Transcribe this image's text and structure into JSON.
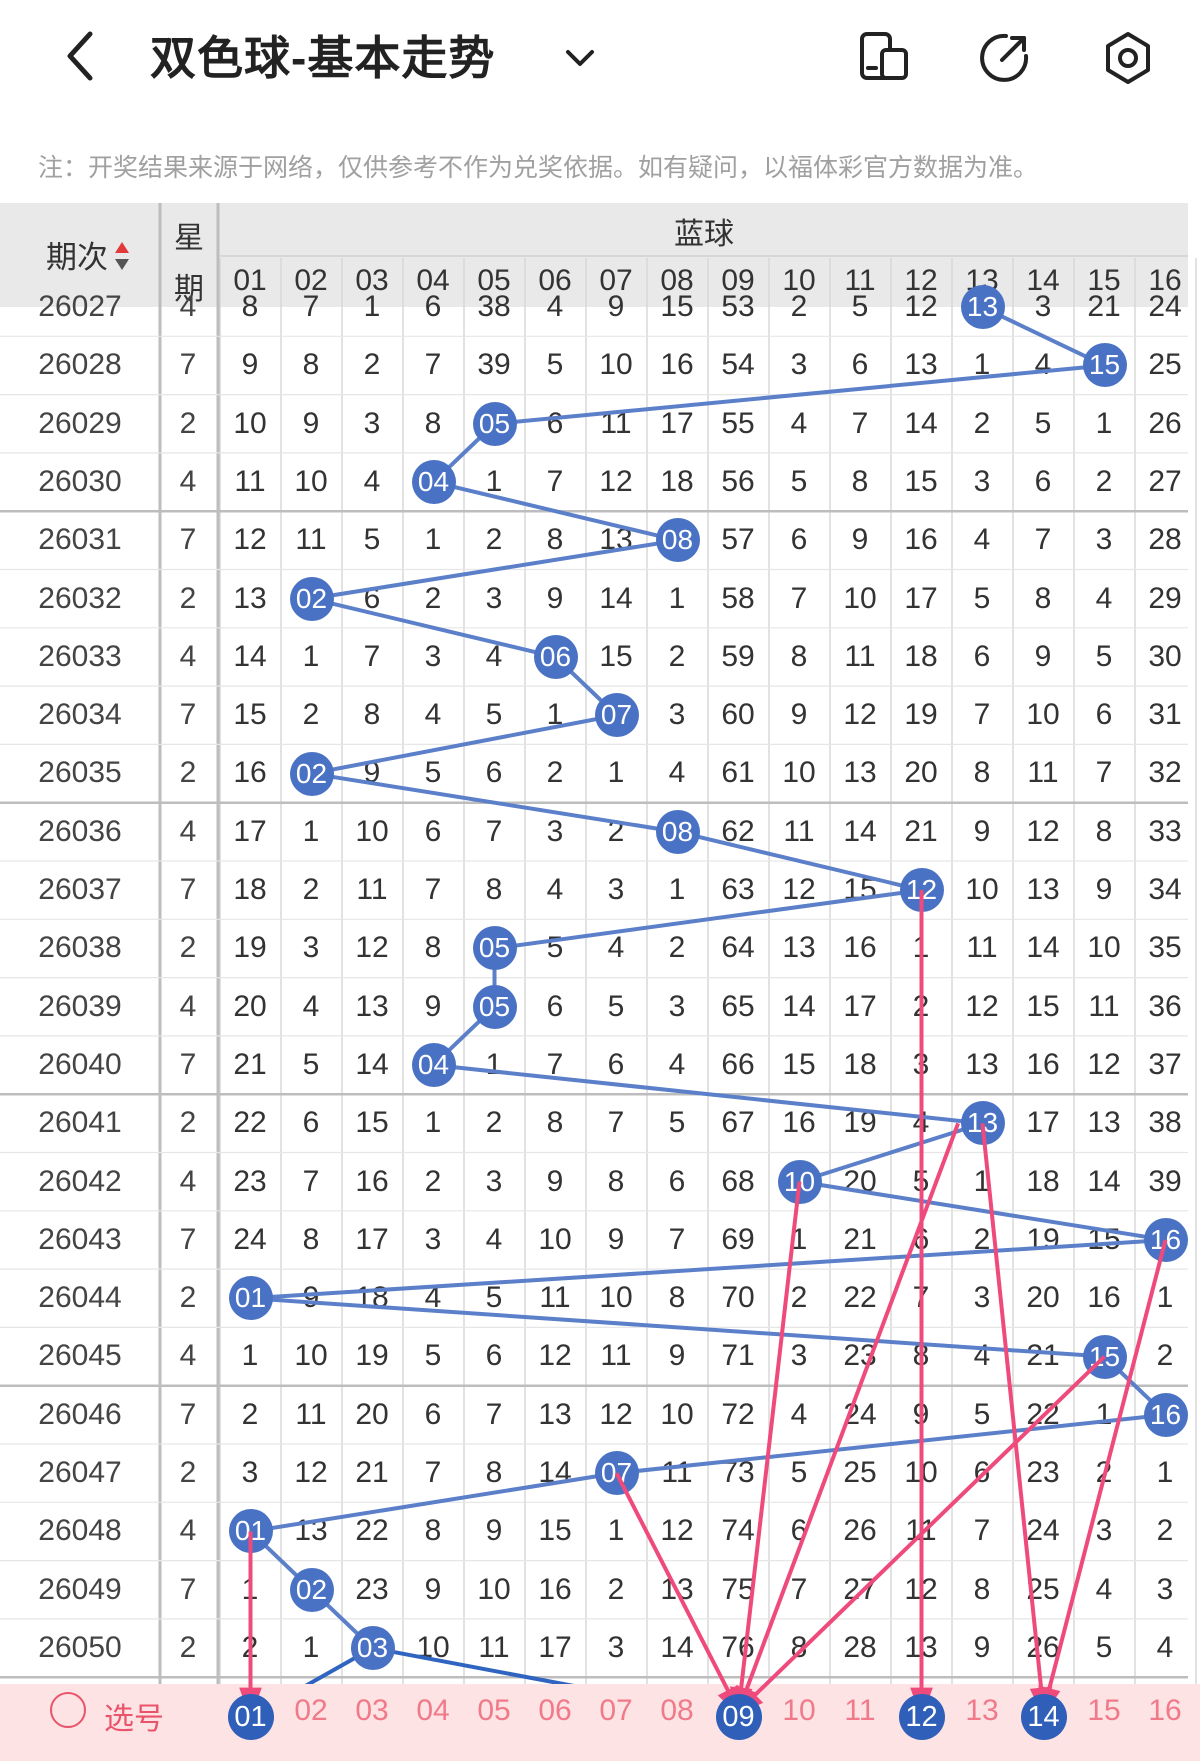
{
  "header": {
    "title": "双色球-基本走势",
    "note": "注：开奖结果来源于网络，仅供参考不作为兑奖依据。如有疑问，以福体彩官方数据为准。"
  },
  "table": {
    "col_period": "期次",
    "col_week_line1": "星",
    "col_week_line2": "期",
    "col_blue": "蓝球",
    "numbers": [
      "01",
      "02",
      "03",
      "04",
      "05",
      "06",
      "07",
      "08",
      "09",
      "10",
      "11",
      "12",
      "13",
      "14",
      "15",
      "16"
    ],
    "rows": [
      {
        "period": "26027",
        "week": "4",
        "cells": [
          "8",
          "7",
          "1",
          "6",
          "38",
          "4",
          "9",
          "15",
          "53",
          "2",
          "5",
          "12",
          "13",
          "3",
          "21",
          "24"
        ],
        "hit": 13
      },
      {
        "period": "26028",
        "week": "7",
        "cells": [
          "9",
          "8",
          "2",
          "7",
          "39",
          "5",
          "10",
          "16",
          "54",
          "3",
          "6",
          "13",
          "1",
          "4",
          "15",
          "25"
        ],
        "hit": 15
      },
      {
        "period": "26029",
        "week": "2",
        "cells": [
          "10",
          "9",
          "3",
          "8",
          "05",
          "6",
          "11",
          "17",
          "55",
          "4",
          "7",
          "14",
          "2",
          "5",
          "1",
          "26"
        ],
        "hit": 5
      },
      {
        "period": "26030",
        "week": "4",
        "cells": [
          "11",
          "10",
          "4",
          "04",
          "1",
          "7",
          "12",
          "18",
          "56",
          "5",
          "8",
          "15",
          "3",
          "6",
          "2",
          "27"
        ],
        "hit": 4
      },
      {
        "period": "26031",
        "week": "7",
        "cells": [
          "12",
          "11",
          "5",
          "1",
          "2",
          "8",
          "13",
          "08",
          "57",
          "6",
          "9",
          "16",
          "4",
          "7",
          "3",
          "28"
        ],
        "hit": 8
      },
      {
        "period": "26032",
        "week": "2",
        "cells": [
          "13",
          "02",
          "6",
          "2",
          "3",
          "9",
          "14",
          "1",
          "58",
          "7",
          "10",
          "17",
          "5",
          "8",
          "4",
          "29"
        ],
        "hit": 2
      },
      {
        "period": "26033",
        "week": "4",
        "cells": [
          "14",
          "1",
          "7",
          "3",
          "4",
          "06",
          "15",
          "2",
          "59",
          "8",
          "11",
          "18",
          "6",
          "9",
          "5",
          "30"
        ],
        "hit": 6
      },
      {
        "period": "26034",
        "week": "7",
        "cells": [
          "15",
          "2",
          "8",
          "4",
          "5",
          "1",
          "07",
          "3",
          "60",
          "9",
          "12",
          "19",
          "7",
          "10",
          "6",
          "31"
        ],
        "hit": 7
      },
      {
        "period": "26035",
        "week": "2",
        "cells": [
          "16",
          "02",
          "9",
          "5",
          "6",
          "2",
          "1",
          "4",
          "61",
          "10",
          "13",
          "20",
          "8",
          "11",
          "7",
          "32"
        ],
        "hit": 2
      },
      {
        "period": "26036",
        "week": "4",
        "cells": [
          "17",
          "1",
          "10",
          "6",
          "7",
          "3",
          "2",
          "08",
          "62",
          "11",
          "14",
          "21",
          "9",
          "12",
          "8",
          "33"
        ],
        "hit": 8
      },
      {
        "period": "26037",
        "week": "7",
        "cells": [
          "18",
          "2",
          "11",
          "7",
          "8",
          "4",
          "3",
          "1",
          "63",
          "12",
          "15",
          "12",
          "10",
          "13",
          "9",
          "34"
        ],
        "hit": 12
      },
      {
        "period": "26038",
        "week": "2",
        "cells": [
          "19",
          "3",
          "12",
          "8",
          "05",
          "5",
          "4",
          "2",
          "64",
          "13",
          "16",
          "1",
          "11",
          "14",
          "10",
          "35"
        ],
        "hit": 5
      },
      {
        "period": "26039",
        "week": "4",
        "cells": [
          "20",
          "4",
          "13",
          "9",
          "05",
          "6",
          "5",
          "3",
          "65",
          "14",
          "17",
          "2",
          "12",
          "15",
          "11",
          "36"
        ],
        "hit": 5
      },
      {
        "period": "26040",
        "week": "7",
        "cells": [
          "21",
          "5",
          "14",
          "04",
          "1",
          "7",
          "6",
          "4",
          "66",
          "15",
          "18",
          "3",
          "13",
          "16",
          "12",
          "37"
        ],
        "hit": 4
      },
      {
        "period": "26041",
        "week": "2",
        "cells": [
          "22",
          "6",
          "15",
          "1",
          "2",
          "8",
          "7",
          "5",
          "67",
          "16",
          "19",
          "4",
          "13",
          "17",
          "13",
          "38"
        ],
        "hit": 13
      },
      {
        "period": "26042",
        "week": "4",
        "cells": [
          "23",
          "7",
          "16",
          "2",
          "3",
          "9",
          "8",
          "6",
          "68",
          "10",
          "20",
          "5",
          "1",
          "18",
          "14",
          "39"
        ],
        "hit": 10
      },
      {
        "period": "26043",
        "week": "7",
        "cells": [
          "24",
          "8",
          "17",
          "3",
          "4",
          "10",
          "9",
          "7",
          "69",
          "1",
          "21",
          "6",
          "2",
          "19",
          "15",
          "16"
        ],
        "hit": 16
      },
      {
        "period": "26044",
        "week": "2",
        "cells": [
          "01",
          "9",
          "18",
          "4",
          "5",
          "11",
          "10",
          "8",
          "70",
          "2",
          "22",
          "7",
          "3",
          "20",
          "16",
          "1"
        ],
        "hit": 1
      },
      {
        "period": "26045",
        "week": "4",
        "cells": [
          "1",
          "10",
          "19",
          "5",
          "6",
          "12",
          "11",
          "9",
          "71",
          "3",
          "23",
          "8",
          "4",
          "21",
          "15",
          "2"
        ],
        "hit": 15
      },
      {
        "period": "26046",
        "week": "7",
        "cells": [
          "2",
          "11",
          "20",
          "6",
          "7",
          "13",
          "12",
          "10",
          "72",
          "4",
          "24",
          "9",
          "5",
          "22",
          "1",
          "16"
        ],
        "hit": 16
      },
      {
        "period": "26047",
        "week": "2",
        "cells": [
          "3",
          "12",
          "21",
          "7",
          "8",
          "14",
          "07",
          "11",
          "73",
          "5",
          "25",
          "10",
          "6",
          "23",
          "2",
          "1"
        ],
        "hit": 7
      },
      {
        "period": "26048",
        "week": "4",
        "cells": [
          "01",
          "13",
          "22",
          "8",
          "9",
          "15",
          "1",
          "12",
          "74",
          "6",
          "26",
          "11",
          "7",
          "24",
          "3",
          "2"
        ],
        "hit": 1
      },
      {
        "period": "26049",
        "week": "7",
        "cells": [
          "1",
          "02",
          "23",
          "9",
          "10",
          "16",
          "2",
          "13",
          "75",
          "7",
          "27",
          "12",
          "8",
          "25",
          "4",
          "3"
        ],
        "hit": 2
      },
      {
        "period": "26050",
        "week": "2",
        "cells": [
          "2",
          "1",
          "03",
          "10",
          "11",
          "17",
          "3",
          "14",
          "76",
          "8",
          "28",
          "13",
          "9",
          "26",
          "5",
          "4"
        ],
        "hit": 3
      }
    ]
  },
  "selection": {
    "label": "选号",
    "selected": [
      "01",
      "09",
      "12",
      "14"
    ]
  },
  "colors": {
    "ball": "#4a72c4",
    "trend_line": "#5b7fc9",
    "arrow": "#ef4a7c",
    "selection_bg": "#fde3e3"
  },
  "icons": [
    "back-icon",
    "chevron-down-icon",
    "device-icon",
    "share-icon",
    "settings-icon",
    "sort-icon"
  ]
}
